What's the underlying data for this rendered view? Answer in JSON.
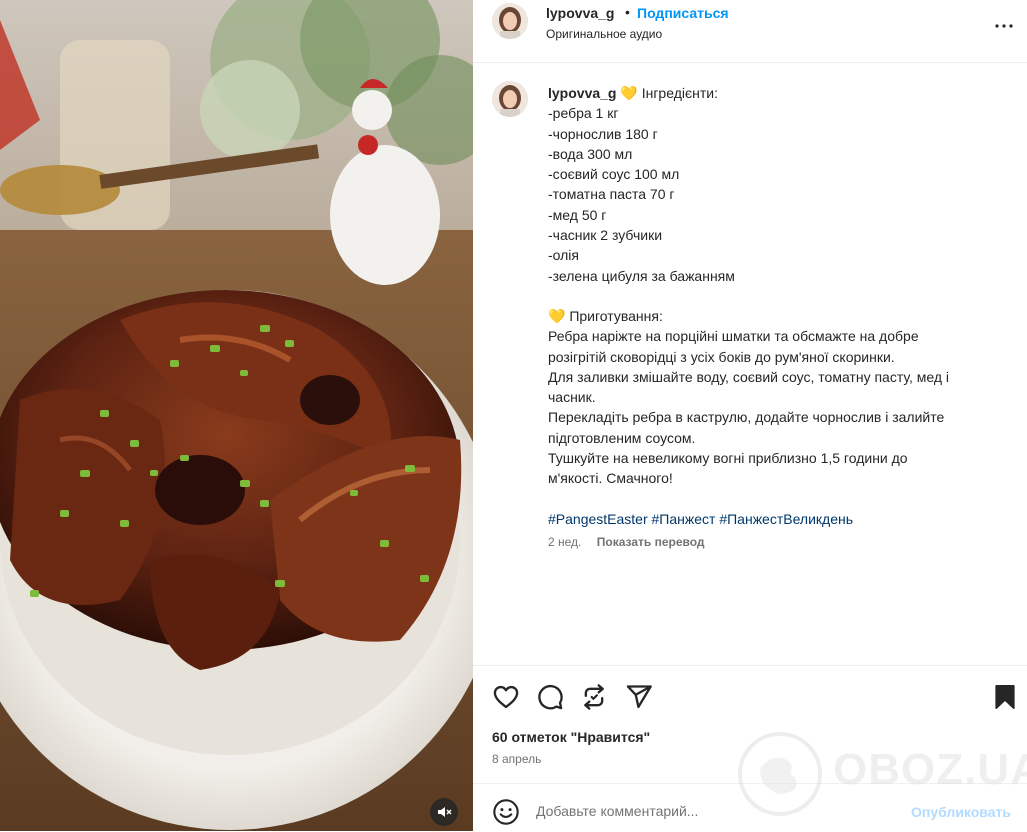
{
  "header": {
    "username": "lypovva_g",
    "dot": "•",
    "follow_label": "Подписаться",
    "audio": "Оригинальное аудио"
  },
  "caption": {
    "username": "lypovva_g",
    "heart1": "💛",
    "lines_before": [
      "Інгредієнти:",
      "-ребра 1 кг",
      "-чорнослив 180 г",
      "-вода 300 мл",
      "-соєвий соус 100 мл",
      "-томатна паста 70 г",
      "-мед 50 г",
      "-часник 2 зубчики",
      "-олія",
      "-зелена цибуля за бажанням"
    ],
    "heart2": "💛",
    "prep_title": "Приготування:",
    "body": [
      "Ребра наріжте на порційні шматки та обсмажте на добре",
      "розігрітій сковорідці з усіх боків до рум'яної скоринки.",
      "Для заливки змішайте воду, соєвий соус, томатну пасту, мед і",
      "часник.",
      "Перекладіть ребра в каструлю, додайте чорнослив і залийте",
      "підготовленим соусом.",
      "Тушкуйте на невеликому вогні приблизно 1,5 години до",
      "м'якості. Смачного!"
    ],
    "hashtags": "#PangestEaster #Панжест #ПанжестВеликдень",
    "age": "2 нед.",
    "translate_label": "Показать перевод"
  },
  "stats": {
    "likes": "60 отметок \"Нравится\"",
    "date": "8 апрель"
  },
  "comment": {
    "placeholder": "Добавьте комментарий...",
    "publish_label": "Опубликовать"
  },
  "watermark": {
    "text": "OBOZ.UA"
  },
  "icons": {
    "like": "heart-icon",
    "comment": "comment-icon",
    "repost": "repost-icon",
    "share": "send-icon",
    "save": "bookmark-icon",
    "more": "more-icon",
    "emoji": "emoji-icon",
    "mute": "muted-speaker-icon"
  },
  "colors": {
    "link_blue": "#0095f6",
    "publish_disabled": "#b3dbff",
    "hashtag": "#00376b",
    "muted_text": "#737373"
  }
}
